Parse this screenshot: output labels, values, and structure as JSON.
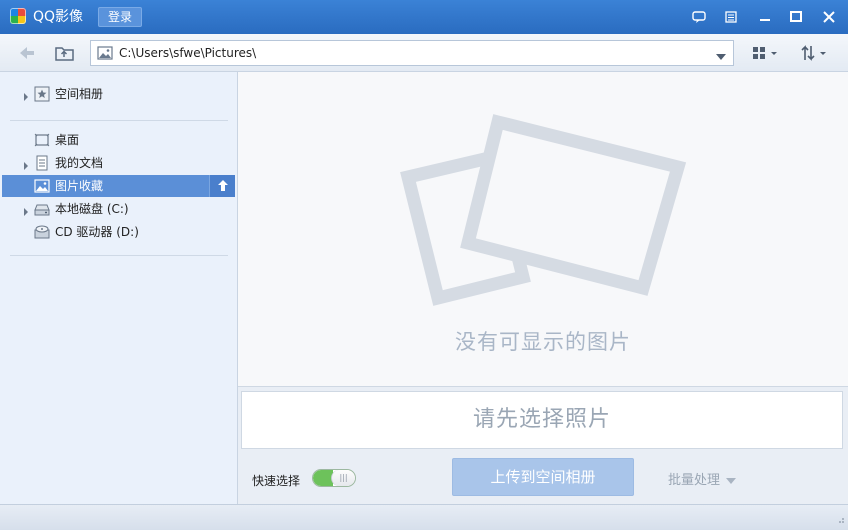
{
  "window": {
    "title": "QQ影像",
    "login_label": "登录",
    "title_icons": [
      "chat-icon",
      "menu-icon",
      "minimize-icon",
      "maximize-icon",
      "close-icon"
    ]
  },
  "toolbar": {
    "address_path": "C:\\Users\\sfwe\\Pictures\\",
    "icons": [
      "back-arrow-icon",
      "folder-up-icon",
      "image-icon",
      "dropdown-icon",
      "view-grid-icon",
      "sort-icon"
    ]
  },
  "sidebar": {
    "items": [
      {
        "label": "空间相册",
        "icon": "star-album-icon",
        "expandable": true
      },
      {
        "label": "桌面",
        "icon": "desktop-icon",
        "expandable": false
      },
      {
        "label": "我的文档",
        "icon": "document-icon",
        "expandable": true
      },
      {
        "label": "图片收藏",
        "icon": "picture-icon",
        "expandable": false,
        "selected": true
      },
      {
        "label": "本地磁盘 (C:)",
        "icon": "hard-drive-icon",
        "expandable": true
      },
      {
        "label": "CD 驱动器 (D:)",
        "icon": "cd-drive-icon",
        "expandable": false
      }
    ]
  },
  "main": {
    "empty_message": "没有可显示的图片"
  },
  "bottom": {
    "select_prompt": "请先选择照片",
    "quick_select_label": "快速选择",
    "quick_select_on": true,
    "upload_label": "上传到空间相册",
    "batch_label": "批量处理"
  },
  "colors": {
    "titlebar": "#2e6fbf",
    "sidebar_bg": "#eaf1fb",
    "selected_bg": "#5b8fd7",
    "upload_btn": "#a9c5ea",
    "toggle_on": "#6dc25b"
  }
}
